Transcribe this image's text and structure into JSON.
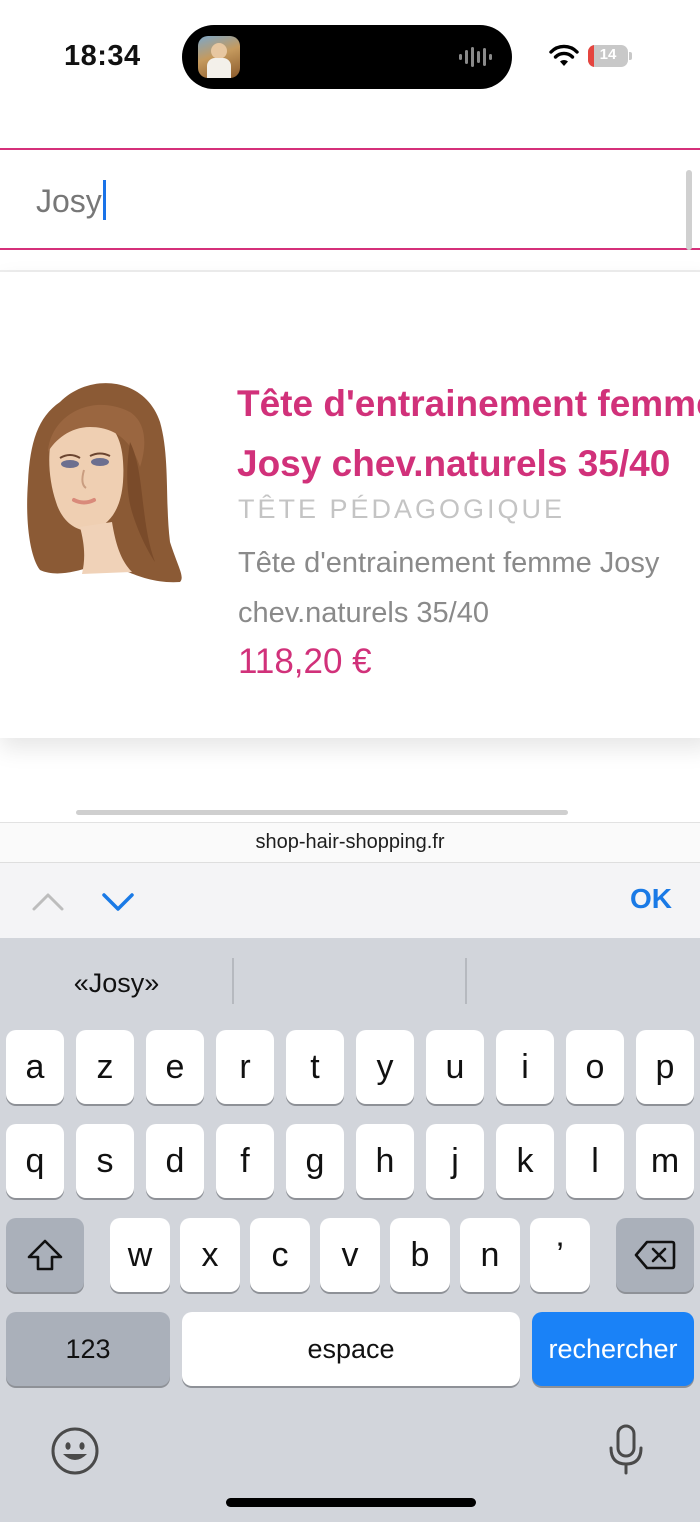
{
  "status_bar": {
    "time": "18:34",
    "battery_level": "14",
    "battery_color": "#e5453f"
  },
  "search": {
    "value": "Josy"
  },
  "product": {
    "title_line1": "Tête d'entrainement femme",
    "title_line2": "Josy chev.naturels 35/40",
    "category": "TÊTE PÉDAGOGIQUE",
    "desc_line1": "Tête d'entrainement femme Josy",
    "desc_line2": "chev.naturels 35/40",
    "price": "118,20 €"
  },
  "browser": {
    "url": "shop-hair-shopping.fr"
  },
  "accessory": {
    "ok_label": "OK"
  },
  "keyboard": {
    "suggestions": [
      "«Josy»",
      "",
      ""
    ],
    "row1": [
      "a",
      "z",
      "e",
      "r",
      "t",
      "y",
      "u",
      "i",
      "o",
      "p"
    ],
    "row2": [
      "q",
      "s",
      "d",
      "f",
      "g",
      "h",
      "j",
      "k",
      "l",
      "m"
    ],
    "row3": [
      "w",
      "x",
      "c",
      "v",
      "b",
      "n",
      "’"
    ],
    "numbers_label": "123",
    "space_label": "espace",
    "action_label": "rechercher"
  },
  "colors": {
    "accent": "#d1317a",
    "keyboard_blue": "#1a82f7",
    "link_blue": "#1a7ae6"
  }
}
